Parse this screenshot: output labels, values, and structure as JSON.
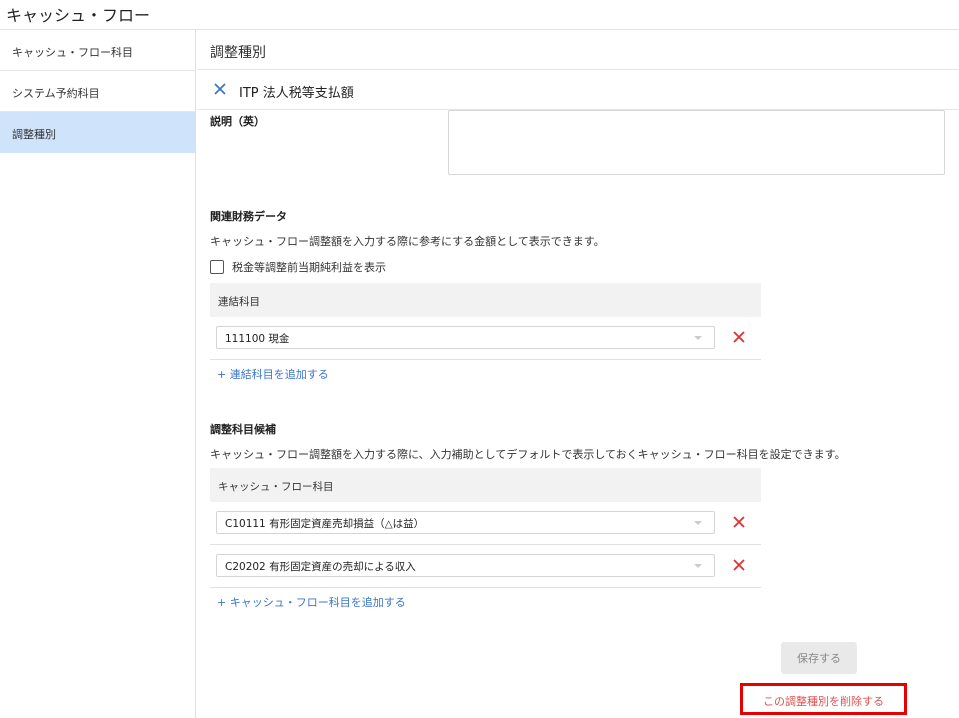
{
  "app": {
    "title": "キャッシュ・フロー"
  },
  "sidebar": {
    "items": [
      {
        "label": "キャッシュ・フロー科目"
      },
      {
        "label": "システム予約科目"
      },
      {
        "label": "調整種別"
      }
    ],
    "active_index": 2
  },
  "main": {
    "header": "調整種別",
    "record_title": "ITP 法人税等支払額"
  },
  "description_en": {
    "label": "説明（英）",
    "value": ""
  },
  "related_data": {
    "title": "関連財務データ",
    "description": "キャッシュ・フロー調整額を入力する際に参考にする金額として表示できます。",
    "checkbox_label": "税金等調整前当期純利益を表示",
    "checkbox_checked": false,
    "table_header": "連結科目",
    "rows": [
      {
        "value": "111100 現金"
      }
    ],
    "add_label": "+ 連結科目を追加する"
  },
  "candidates": {
    "title": "調整科目候補",
    "description": "キャッシュ・フロー調整額を入力する際に、入力補助としてデフォルトで表示しておくキャッシュ・フロー科目を設定できます。",
    "table_header": "キャッシュ・フロー科目",
    "rows": [
      {
        "value": "C10111 有形固定資産売却損益（△は益）"
      },
      {
        "value": "C20202 有形固定資産の売却による収入"
      }
    ],
    "add_label": "+ キャッシュ・フロー科目を追加する"
  },
  "actions": {
    "save_label": "保存する",
    "delete_label": "この調整種別を削除する"
  },
  "colors": {
    "accent": "#3a76c9",
    "sidebar_active": "#cfe3fb",
    "delete_x": "#e03030",
    "highlight_border": "#e60000"
  },
  "icons": {
    "close": "close-icon",
    "remove": "remove-icon",
    "caret": "chevron-down-icon"
  }
}
